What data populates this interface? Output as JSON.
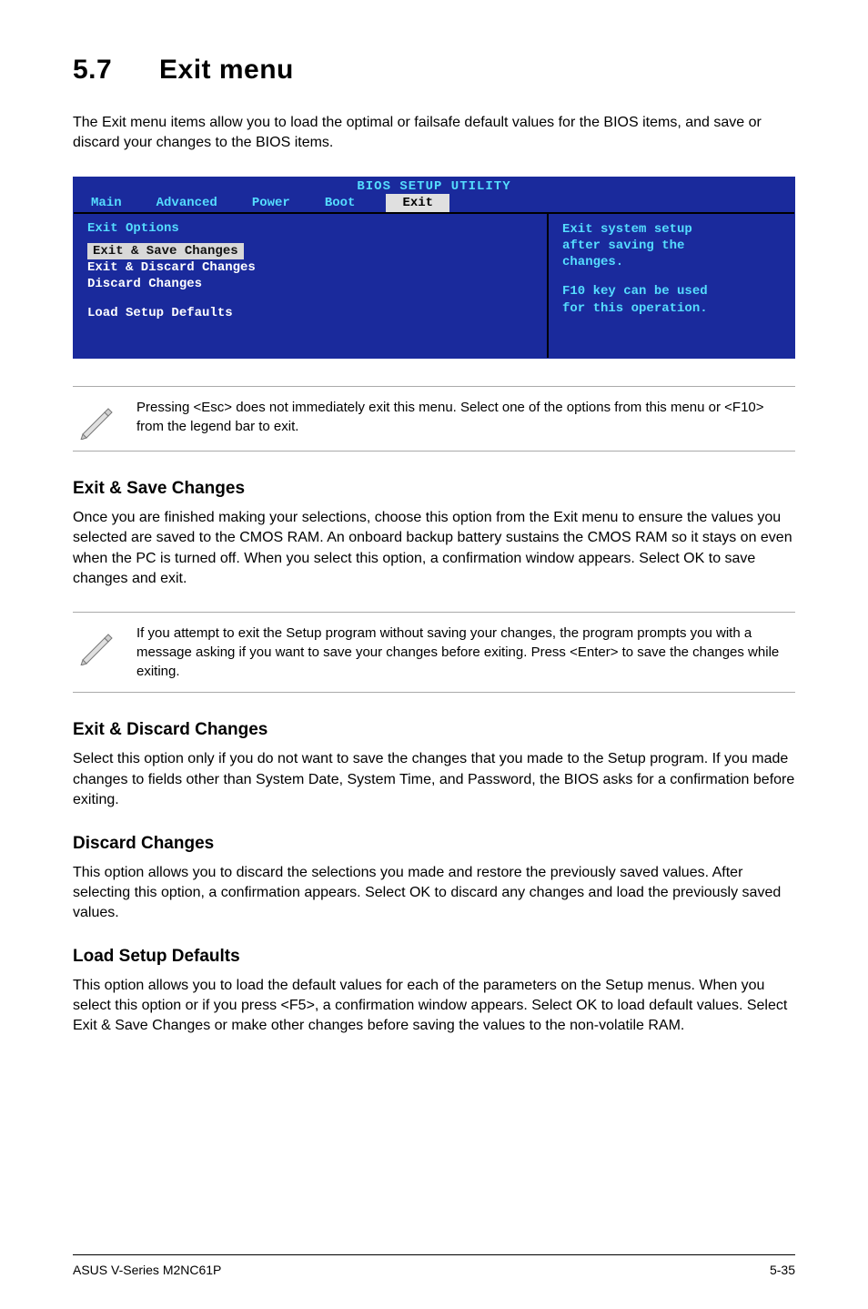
{
  "section": {
    "number": "5.7",
    "title": "Exit menu"
  },
  "intro": "The Exit menu items allow you to load the optimal or failsafe default values for the BIOS items, and save or discard your changes to the BIOS items.",
  "bios": {
    "title": "BIOS SETUP UTILITY",
    "tabs": {
      "main": "Main",
      "advanced": "Advanced",
      "power": "Power",
      "boot": "Boot",
      "exit": "Exit"
    },
    "left": {
      "heading": "Exit Options",
      "items": {
        "save": "Exit & Save Changes",
        "discard_exit": "Exit & Discard Changes",
        "discard": "Discard Changes",
        "load_defaults": "Load Setup Defaults"
      }
    },
    "right": {
      "l1": "Exit system setup",
      "l2": "after saving the",
      "l3": "changes.",
      "l4": "F10 key can be used",
      "l5": "for this operation."
    }
  },
  "note1": "Pressing <Esc> does not immediately exit this menu. Select one of the options from this menu or <F10> from the legend bar to exit.",
  "sections": {
    "s1": {
      "title": "Exit & Save Changes",
      "body": "Once you are finished making your selections, choose this option from the Exit menu to ensure the values you selected are saved to the CMOS RAM. An onboard backup battery sustains the CMOS RAM so it stays on even when the PC is turned off. When you select this option, a confirmation window appears. Select OK to save changes and exit."
    },
    "s2": {
      "title": "Exit & Discard Changes",
      "body": "Select this option only if you do not want to save the changes that you  made to the Setup program. If you made changes to fields other than System Date, System Time, and Password, the BIOS asks for a confirmation before exiting."
    },
    "s3": {
      "title": "Discard Changes",
      "body": "This option allows you to discard the selections you made and restore the previously saved values. After selecting this option, a confirmation appears. Select OK to discard any changes and load the previously saved values."
    },
    "s4": {
      "title": "Load Setup Defaults",
      "body": "This option allows you to load the default values for each of the parameters on the Setup menus. When you select this option or if you press <F5>, a confirmation window appears. Select OK to load default values. Select Exit & Save Changes or make other changes before saving the values to the non-volatile RAM."
    }
  },
  "note2": " If you attempt to exit the Setup program without saving your changes, the program prompts you with a message asking if you want to save your changes before exiting. Press <Enter>  to save the  changes while exiting.",
  "footer": {
    "left": "ASUS V-Series M2NC61P",
    "right": "5-35"
  }
}
